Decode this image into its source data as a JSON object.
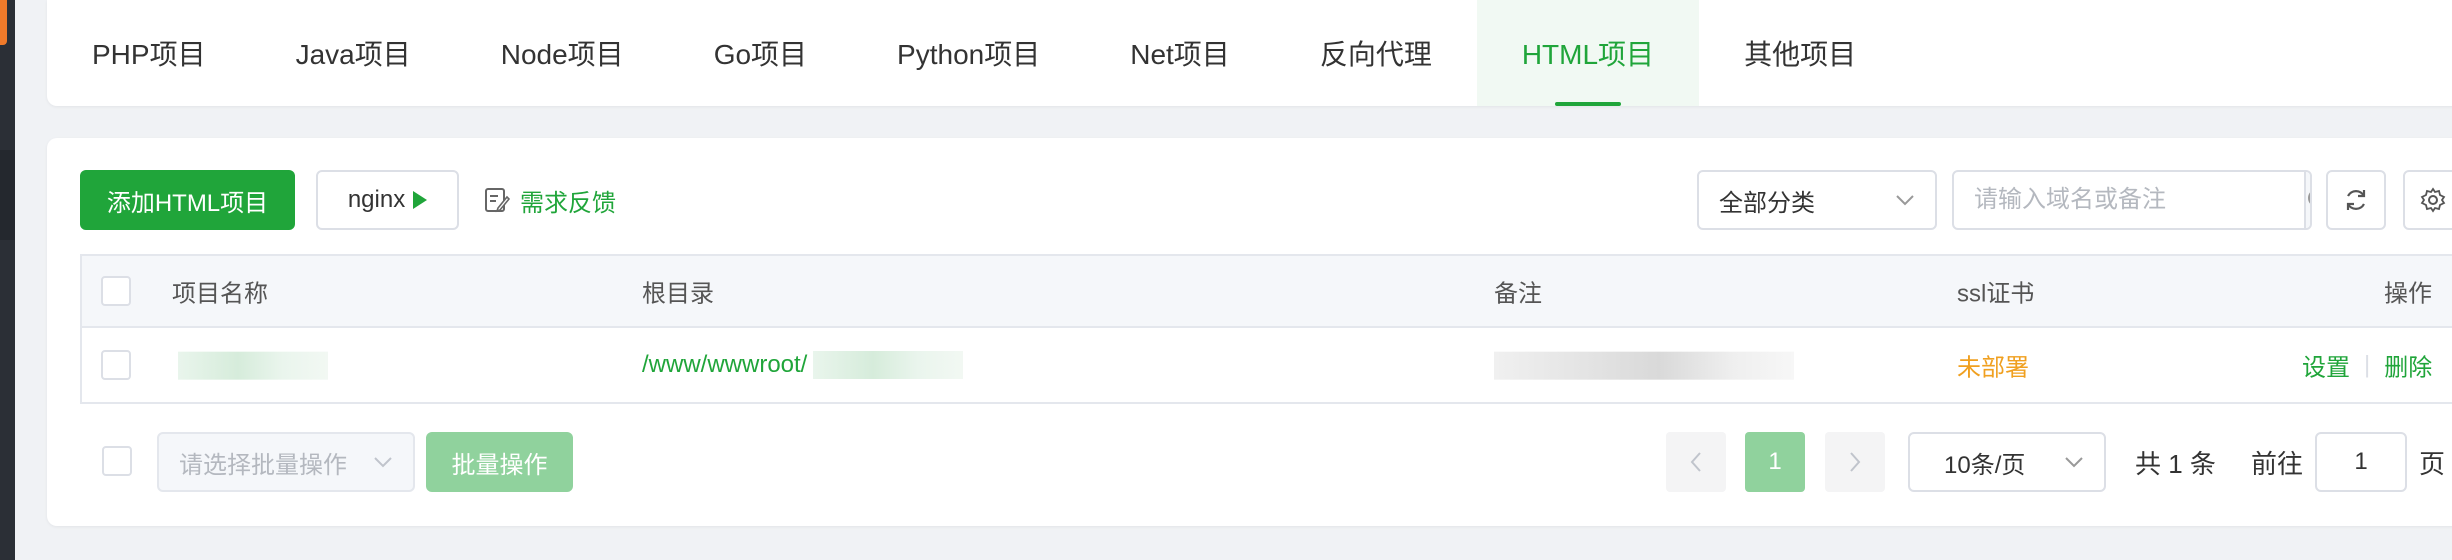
{
  "tabs": [
    {
      "label": "PHP项目",
      "active": false
    },
    {
      "label": "Java项目",
      "active": false
    },
    {
      "label": "Node项目",
      "active": false
    },
    {
      "label": "Go项目",
      "active": false
    },
    {
      "label": "Python项目",
      "active": false
    },
    {
      "label": "Net项目",
      "active": false
    },
    {
      "label": "反向代理",
      "active": false
    },
    {
      "label": "HTML项目",
      "active": true
    },
    {
      "label": "其他项目",
      "active": false
    }
  ],
  "toolbar": {
    "add_label": "添加HTML项目",
    "nginx_label": "nginx",
    "feedback_label": "需求反馈",
    "category_value": "全部分类",
    "search_placeholder": "请输入域名或备注"
  },
  "table": {
    "headers": {
      "name": "项目名称",
      "root": "根目录",
      "note": "备注",
      "ssl": "ssl证书",
      "ops": "操作"
    },
    "rows": [
      {
        "root_prefix": "/www/wwwroot/",
        "ssl": "未部署",
        "op_settings": "设置",
        "op_delete": "删除"
      }
    ]
  },
  "footer": {
    "batch_placeholder": "请选择批量操作",
    "batch_button": "批量操作",
    "current_page": "1",
    "page_size": "10条/页",
    "total": "共 1 条",
    "goto_label": "前往",
    "goto_value": "1",
    "goto_suffix": "页"
  },
  "colors": {
    "accent": "#20a53a",
    "accent_light": "#90d29d",
    "warning": "#f0a020"
  }
}
